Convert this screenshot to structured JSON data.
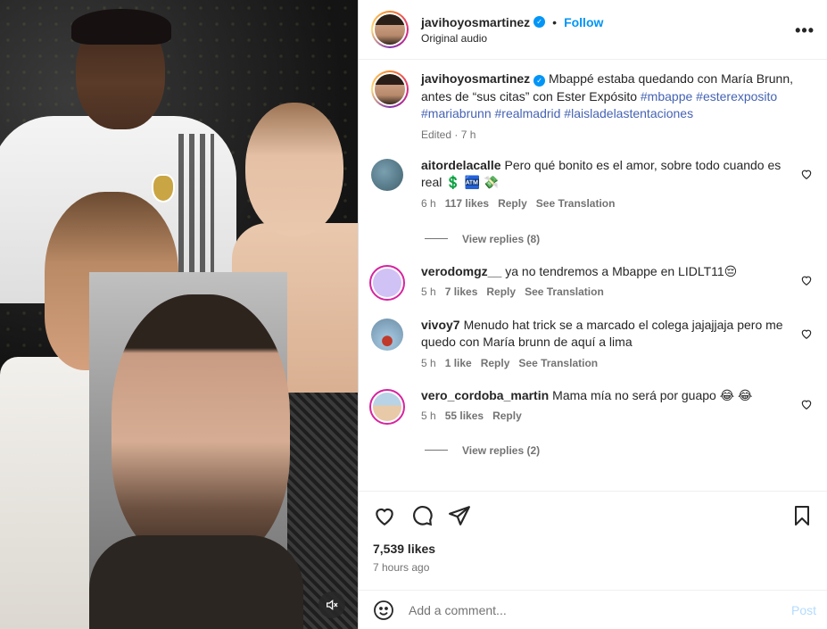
{
  "post": {
    "username": "javihoyosmartinez",
    "follow_label": "Follow",
    "separator": "•",
    "audio": "Original audio",
    "more": "•••"
  },
  "caption": {
    "username": "javihoyosmartinez",
    "text": "Mbappé estaba quedando con María Brunn, antes de “sus citas” con Ester Expósito",
    "hashtags": "#mbappe #esterexposito #mariabrunn #realmadrid #laisladelastentaciones",
    "meta": "Edited · 7 h"
  },
  "comments": [
    {
      "username": "aitordelacalle",
      "text": "Pero qué bonito es el amor, sobre todo cuando es real 💲 🏧 💸",
      "time": "6 h",
      "likes": "117 likes",
      "reply": "Reply",
      "translate": "See Translation",
      "replies": "View replies (8)",
      "avatar_color": "#5f7f8f"
    },
    {
      "username": "verodomgz__",
      "text": "ya no tendremos a Mbappe en LIDLT11😔",
      "time": "5 h",
      "likes": "7 likes",
      "reply": "Reply",
      "translate": "See Translation",
      "avatar_color": "#d1c2f5"
    },
    {
      "username": "vivoy7",
      "text": "Menudo hat trick se a marcado el colega jajajjaja pero me quedo con María brunn de aquí a lima",
      "time": "5 h",
      "likes": "1 like",
      "reply": "Reply",
      "translate": "See Translation",
      "avatar_color": "#7b9fb8"
    },
    {
      "username": "vero_cordoba_martin",
      "text": "Mama mía no será por guapo 😂 😂",
      "time": "5 h",
      "likes": "55 likes",
      "reply": "Reply",
      "replies": "View replies (2)",
      "avatar_color": "#e8c9a8"
    }
  ],
  "actions": {
    "likes": "7,539 likes",
    "ago": "7 hours ago"
  },
  "composer": {
    "placeholder": "Add a comment...",
    "post_label": "Post"
  },
  "colors": {
    "accent": "#0095f6",
    "hashtag": "#4563b4",
    "muted": "#737373"
  }
}
